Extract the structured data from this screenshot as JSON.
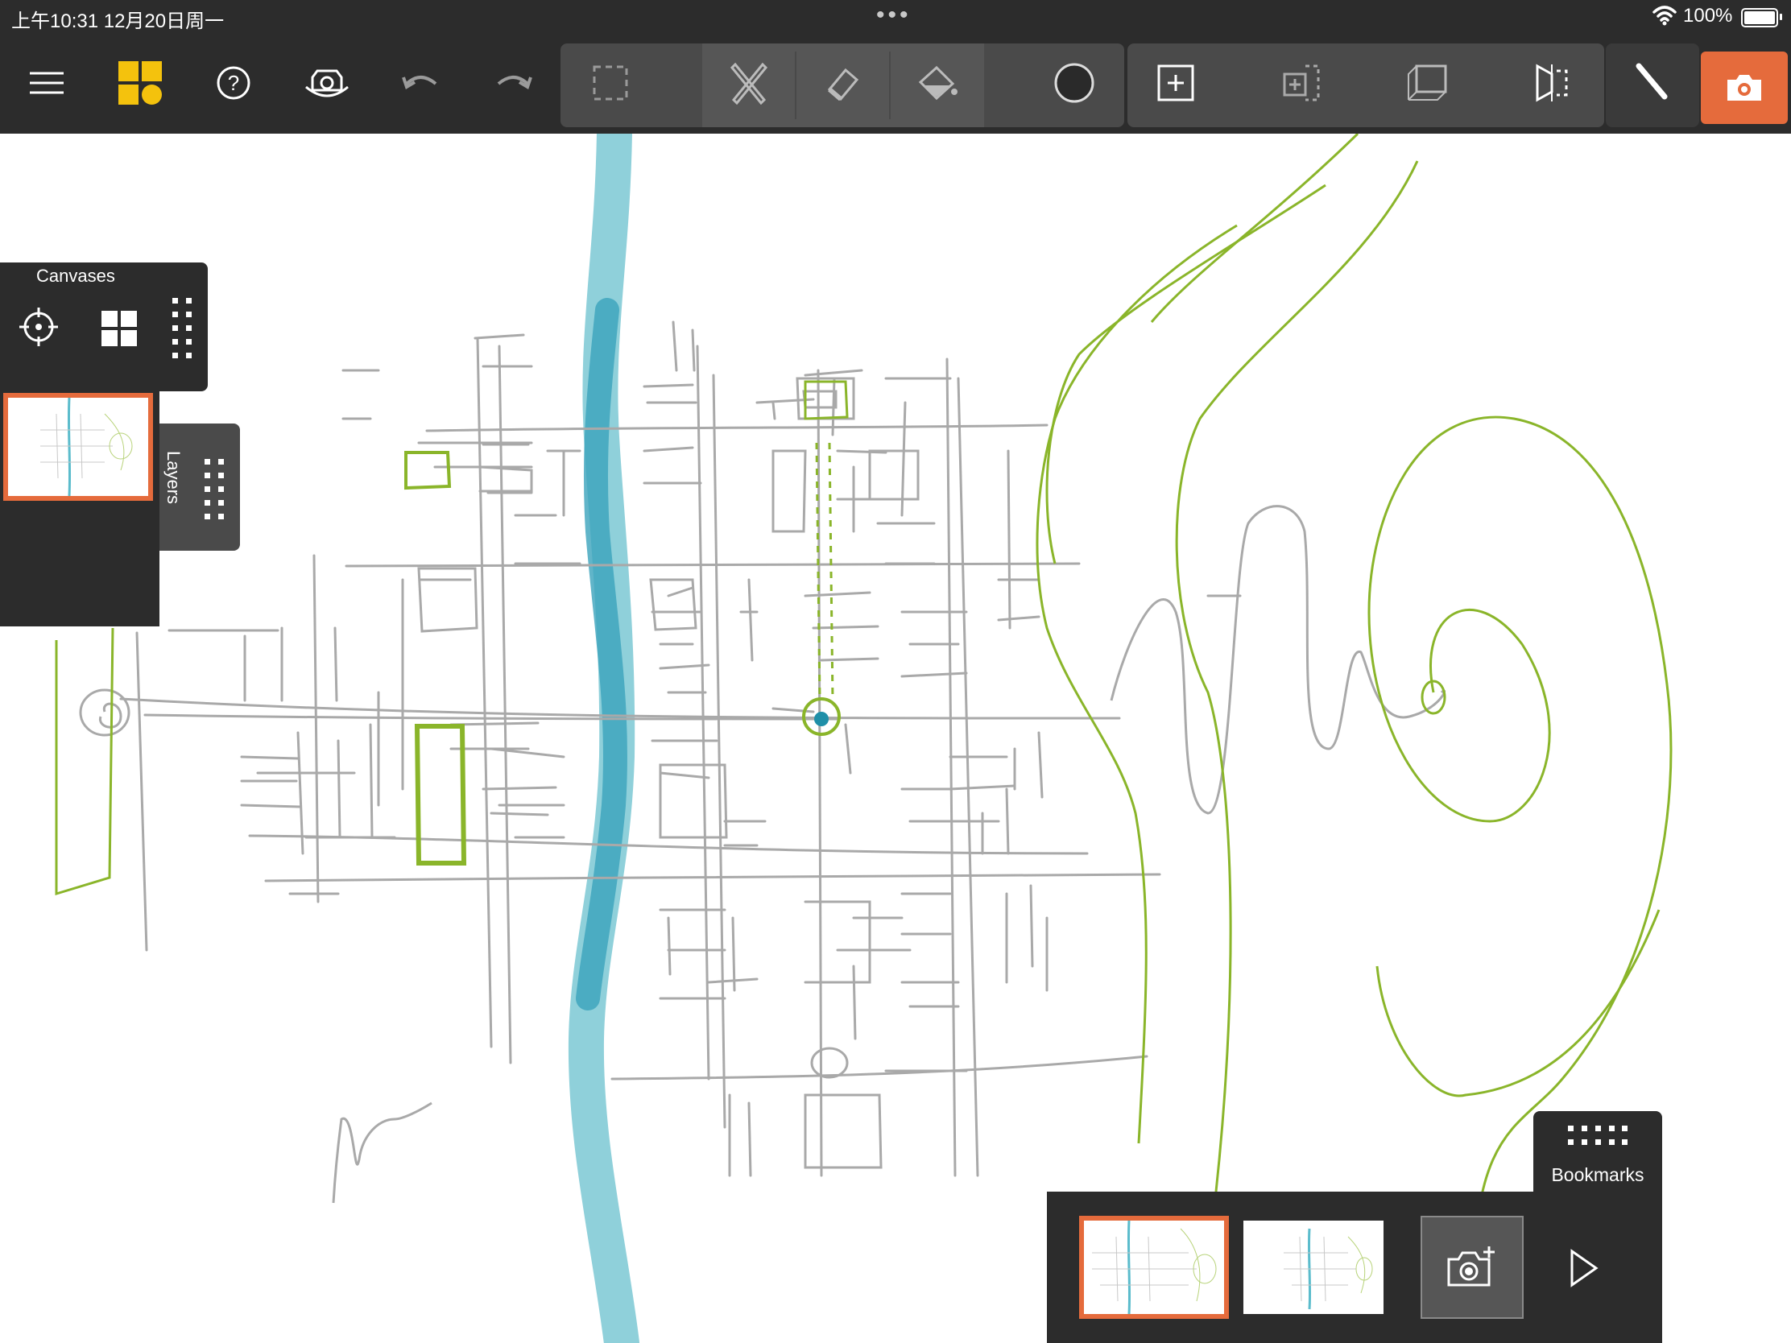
{
  "status_bar": {
    "time_date": "上午10:31   12月20日周一",
    "battery_percent": "100%",
    "icons": [
      "multitask-dots-icon",
      "wifi-icon",
      "battery-icon"
    ]
  },
  "toolbar": {
    "buttons": [
      "menu-icon",
      "gallery-icon",
      "help-icon",
      "hide-ui-icon",
      "undo-icon",
      "redo-icon",
      "selection-icon",
      "pencil-ruler-icon",
      "eraser-icon",
      "fill-bucket-icon",
      "color-swatch-icon",
      "add-canvas-icon",
      "transform-canvas-icon",
      "perspective-icon",
      "flip-icon",
      "brush-icon",
      "camera-icon"
    ],
    "accent_color": "#e56b3c",
    "current_color": "#2a2a2a"
  },
  "canvases_panel": {
    "title": "Canvases",
    "icons": [
      "crosshair-icon",
      "grid-view-icon",
      "drag-handle-icon"
    ]
  },
  "layers_tab": {
    "label": "Layers"
  },
  "bookmarks": {
    "label": "Bookmarks",
    "items": [
      "bookmark-1",
      "bookmark-2"
    ],
    "icons": [
      "drag-handle-icon",
      "add-bookmark-camera-icon",
      "play-icon"
    ]
  },
  "drawing_colors": {
    "streets": "#a9a9a9",
    "river": "#5bbccc",
    "parks": "#8ab52a"
  }
}
